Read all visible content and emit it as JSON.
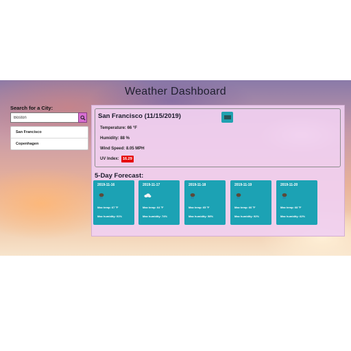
{
  "header": {
    "title": "Weather Dashboard"
  },
  "search": {
    "label": "Search for a City:",
    "value": "Boston",
    "button_icon": "search-icon"
  },
  "history": [
    {
      "label": "San Francisco"
    },
    {
      "label": "Copenhagen"
    }
  ],
  "current": {
    "heading": "San Francisco (11/15/2019)",
    "icon": "weather-icon",
    "temperature": "Temperature: 66 °F",
    "humidity": "Humidity: 88 %",
    "wind": "Wind Speed: 8.05 MPH",
    "uv_label": "UV Index:",
    "uv_value": "16.29"
  },
  "forecast": {
    "title": "5-Day Forecast:",
    "days": [
      {
        "date": "2019-11-16",
        "icon": "rain-icon",
        "temp": "Max temp: 67 °F",
        "humidity": "Max humidity: 91%"
      },
      {
        "date": "2019-11-17",
        "icon": "cloud-icon",
        "temp": "Max temp: 64 °F",
        "humidity": "Max humidity: 74%"
      },
      {
        "date": "2019-11-18",
        "icon": "rain-icon",
        "temp": "Max temp: 65 °F",
        "humidity": "Max humidity: 58%"
      },
      {
        "date": "2019-11-19",
        "icon": "rain-icon",
        "temp": "Max temp: 66 °F",
        "humidity": "Max humidity: 92%"
      },
      {
        "date": "2019-11-20",
        "icon": "rain-icon",
        "temp": "Max temp: 68 °F",
        "humidity": "Max humidity: 62%"
      }
    ]
  },
  "colors": {
    "card": "#1ca2b4",
    "panel": "#f0d0f0",
    "search_button": "#d76fd1",
    "uv_badge": "#e60b0b"
  }
}
